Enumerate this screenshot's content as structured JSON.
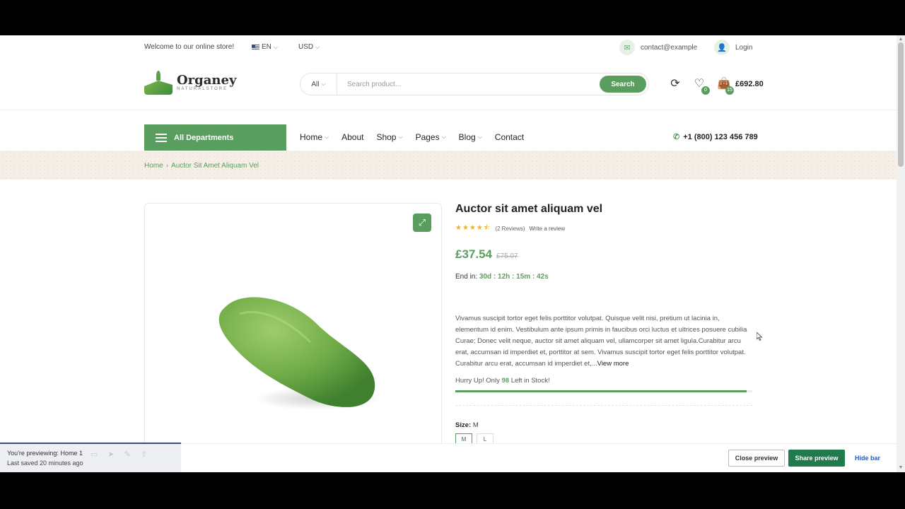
{
  "topbar": {
    "welcome": "Welcome to our online store!",
    "language": "EN",
    "currency": "USD",
    "contact_email": "contact@example",
    "login_label": "Login"
  },
  "header": {
    "logo_name": "Organey",
    "logo_sub": "NATURALSTORE",
    "search_category": "All",
    "search_placeholder": "Search product...",
    "search_button": "Search",
    "wishlist_count": "0",
    "cart_count": "15",
    "cart_total": "£692.80"
  },
  "nav": {
    "departments_label": "All Departments",
    "items": [
      {
        "label": "Home",
        "has_dropdown": true
      },
      {
        "label": "About",
        "has_dropdown": false
      },
      {
        "label": "Shop",
        "has_dropdown": true
      },
      {
        "label": "Pages",
        "has_dropdown": true
      },
      {
        "label": "Blog",
        "has_dropdown": true
      },
      {
        "label": "Contact",
        "has_dropdown": false
      }
    ],
    "phone": "+1 (800) 123 456 789"
  },
  "breadcrumb": {
    "home": "Home",
    "separator": "›",
    "current": "Auctor Sit Amet Aliquam Vel"
  },
  "product": {
    "title": "Auctor sit amet aliquam vel",
    "rating": 4.5,
    "reviews": "(2 Reviews)",
    "write_review": "Write a review",
    "price": "£37.54",
    "old_price": "£75.07",
    "end_in_label": "End in:",
    "countdown": "30d : 12h : 15m : 42s",
    "description": "Vivamus suscipit tortor eget felis porttitor volutpat. Quisque velit nisi, pretium ut lacinia in, elementum id enim. Vestibulum ante ipsum primis in faucibus orci luctus et ultrices posuere cubilia Curae; Donec velit neque, auctor sit amet aliquam vel, ullamcorper sit amet ligula.Curabitur arcu erat, accumsan id imperdiet et, porttitor at sem. Vivamus suscipit tortor eget felis porttitor volutpat. Curabitur arcu erat, accumsan id imperdiet et,...",
    "view_more": "View more",
    "stock_prefix": "Hurry Up! Only",
    "stock_count": "98",
    "stock_suffix": "Left in Stock!",
    "stock_fraction": 0.98,
    "size_label": "Size:",
    "size_value": "M",
    "size_options": [
      "M",
      "L"
    ]
  },
  "preview_bar": {
    "previewing_label": "You're previewing:",
    "previewing_page": "Home 1",
    "last_saved": "Last saved 20 minutes ago",
    "close_preview": "Close preview",
    "share_preview": "Share preview",
    "hide_bar": "Hide bar"
  },
  "colors": {
    "accent": "#5a9e5f",
    "share_button": "#1f7a4d",
    "star": "#f2b01e"
  }
}
